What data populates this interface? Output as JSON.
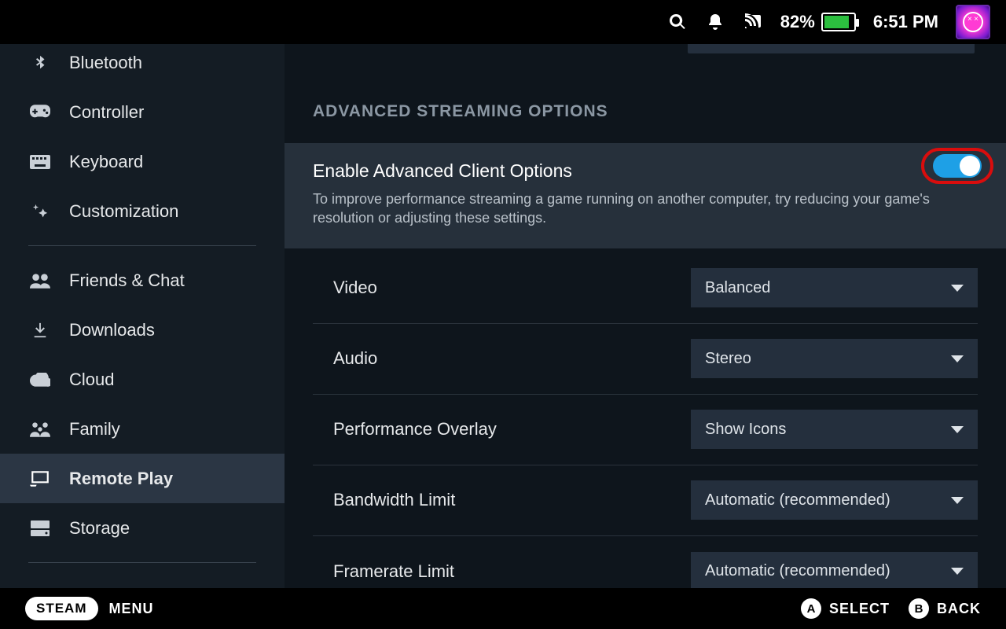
{
  "status": {
    "battery_pct": "82%",
    "clock": "6:51 PM"
  },
  "sidebar": {
    "items": [
      {
        "label": "Bluetooth"
      },
      {
        "label": "Controller"
      },
      {
        "label": "Keyboard"
      },
      {
        "label": "Customization"
      },
      {
        "label": "Friends & Chat"
      },
      {
        "label": "Downloads"
      },
      {
        "label": "Cloud"
      },
      {
        "label": "Family"
      },
      {
        "label": "Remote Play"
      },
      {
        "label": "Storage"
      }
    ]
  },
  "content": {
    "section_title": "ADVANCED STREAMING OPTIONS",
    "advanced": {
      "title": "Enable Advanced Client Options",
      "desc": "To improve performance streaming a game running on another computer, try reducing your game's resolution or adjusting these settings.",
      "enabled": true
    },
    "rows": [
      {
        "label": "Video",
        "value": "Balanced"
      },
      {
        "label": "Audio",
        "value": "Stereo"
      },
      {
        "label": "Performance Overlay",
        "value": "Show Icons"
      },
      {
        "label": "Bandwidth Limit",
        "value": "Automatic (recommended)"
      },
      {
        "label": "Framerate Limit",
        "value": "Automatic (recommended)"
      }
    ]
  },
  "footer": {
    "steam": "STEAM",
    "menu": "MENU",
    "a": "A",
    "select": "SELECT",
    "b": "B",
    "back": "BACK"
  }
}
